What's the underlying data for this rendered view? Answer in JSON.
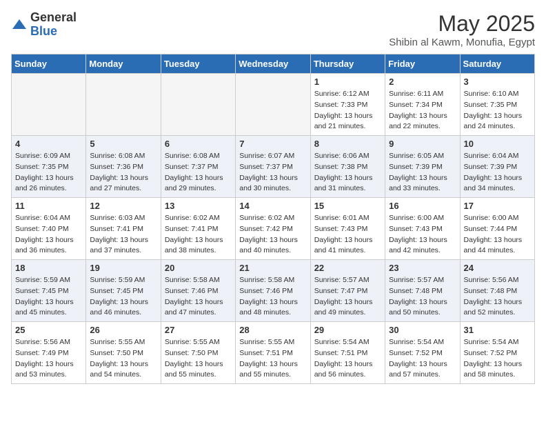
{
  "logo": {
    "general": "General",
    "blue": "Blue"
  },
  "header": {
    "month": "May 2025",
    "location": "Shibin al Kawm, Monufia, Egypt"
  },
  "days_of_week": [
    "Sunday",
    "Monday",
    "Tuesday",
    "Wednesday",
    "Thursday",
    "Friday",
    "Saturday"
  ],
  "weeks": [
    [
      {
        "day": "",
        "empty": true
      },
      {
        "day": "",
        "empty": true
      },
      {
        "day": "",
        "empty": true
      },
      {
        "day": "",
        "empty": true
      },
      {
        "day": "1",
        "sunrise": "6:12 AM",
        "sunset": "7:33 PM",
        "daylight": "13 hours and 21 minutes."
      },
      {
        "day": "2",
        "sunrise": "6:11 AM",
        "sunset": "7:34 PM",
        "daylight": "13 hours and 22 minutes."
      },
      {
        "day": "3",
        "sunrise": "6:10 AM",
        "sunset": "7:35 PM",
        "daylight": "13 hours and 24 minutes."
      }
    ],
    [
      {
        "day": "4",
        "sunrise": "6:09 AM",
        "sunset": "7:35 PM",
        "daylight": "13 hours and 26 minutes."
      },
      {
        "day": "5",
        "sunrise": "6:08 AM",
        "sunset": "7:36 PM",
        "daylight": "13 hours and 27 minutes."
      },
      {
        "day": "6",
        "sunrise": "6:08 AM",
        "sunset": "7:37 PM",
        "daylight": "13 hours and 29 minutes."
      },
      {
        "day": "7",
        "sunrise": "6:07 AM",
        "sunset": "7:37 PM",
        "daylight": "13 hours and 30 minutes."
      },
      {
        "day": "8",
        "sunrise": "6:06 AM",
        "sunset": "7:38 PM",
        "daylight": "13 hours and 31 minutes."
      },
      {
        "day": "9",
        "sunrise": "6:05 AM",
        "sunset": "7:39 PM",
        "daylight": "13 hours and 33 minutes."
      },
      {
        "day": "10",
        "sunrise": "6:04 AM",
        "sunset": "7:39 PM",
        "daylight": "13 hours and 34 minutes."
      }
    ],
    [
      {
        "day": "11",
        "sunrise": "6:04 AM",
        "sunset": "7:40 PM",
        "daylight": "13 hours and 36 minutes."
      },
      {
        "day": "12",
        "sunrise": "6:03 AM",
        "sunset": "7:41 PM",
        "daylight": "13 hours and 37 minutes."
      },
      {
        "day": "13",
        "sunrise": "6:02 AM",
        "sunset": "7:41 PM",
        "daylight": "13 hours and 38 minutes."
      },
      {
        "day": "14",
        "sunrise": "6:02 AM",
        "sunset": "7:42 PM",
        "daylight": "13 hours and 40 minutes."
      },
      {
        "day": "15",
        "sunrise": "6:01 AM",
        "sunset": "7:43 PM",
        "daylight": "13 hours and 41 minutes."
      },
      {
        "day": "16",
        "sunrise": "6:00 AM",
        "sunset": "7:43 PM",
        "daylight": "13 hours and 42 minutes."
      },
      {
        "day": "17",
        "sunrise": "6:00 AM",
        "sunset": "7:44 PM",
        "daylight": "13 hours and 44 minutes."
      }
    ],
    [
      {
        "day": "18",
        "sunrise": "5:59 AM",
        "sunset": "7:45 PM",
        "daylight": "13 hours and 45 minutes."
      },
      {
        "day": "19",
        "sunrise": "5:59 AM",
        "sunset": "7:45 PM",
        "daylight": "13 hours and 46 minutes."
      },
      {
        "day": "20",
        "sunrise": "5:58 AM",
        "sunset": "7:46 PM",
        "daylight": "13 hours and 47 minutes."
      },
      {
        "day": "21",
        "sunrise": "5:58 AM",
        "sunset": "7:46 PM",
        "daylight": "13 hours and 48 minutes."
      },
      {
        "day": "22",
        "sunrise": "5:57 AM",
        "sunset": "7:47 PM",
        "daylight": "13 hours and 49 minutes."
      },
      {
        "day": "23",
        "sunrise": "5:57 AM",
        "sunset": "7:48 PM",
        "daylight": "13 hours and 50 minutes."
      },
      {
        "day": "24",
        "sunrise": "5:56 AM",
        "sunset": "7:48 PM",
        "daylight": "13 hours and 52 minutes."
      }
    ],
    [
      {
        "day": "25",
        "sunrise": "5:56 AM",
        "sunset": "7:49 PM",
        "daylight": "13 hours and 53 minutes."
      },
      {
        "day": "26",
        "sunrise": "5:55 AM",
        "sunset": "7:50 PM",
        "daylight": "13 hours and 54 minutes."
      },
      {
        "day": "27",
        "sunrise": "5:55 AM",
        "sunset": "7:50 PM",
        "daylight": "13 hours and 55 minutes."
      },
      {
        "day": "28",
        "sunrise": "5:55 AM",
        "sunset": "7:51 PM",
        "daylight": "13 hours and 55 minutes."
      },
      {
        "day": "29",
        "sunrise": "5:54 AM",
        "sunset": "7:51 PM",
        "daylight": "13 hours and 56 minutes."
      },
      {
        "day": "30",
        "sunrise": "5:54 AM",
        "sunset": "7:52 PM",
        "daylight": "13 hours and 57 minutes."
      },
      {
        "day": "31",
        "sunrise": "5:54 AM",
        "sunset": "7:52 PM",
        "daylight": "13 hours and 58 minutes."
      }
    ]
  ]
}
